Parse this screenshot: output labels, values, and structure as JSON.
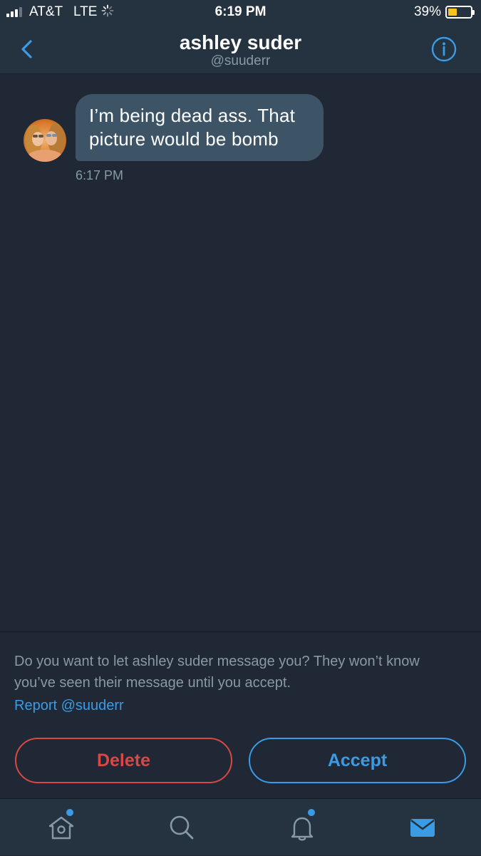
{
  "status_bar": {
    "carrier": "AT&T",
    "network": "LTE",
    "time": "6:19 PM",
    "battery_percent_label": "39%",
    "battery_level": 0.39
  },
  "header": {
    "title": "ashley suder",
    "handle": "@suuderr",
    "back_icon": "chevron-left-icon",
    "info_icon": "info-icon"
  },
  "conversation": {
    "messages": [
      {
        "text": "I’m being dead ass. That picture would be bomb",
        "time": "6:17 PM"
      }
    ]
  },
  "request": {
    "prompt": "Do you want to let ashley suder message you? They won’t know you’ve seen their message until you accept.",
    "report_label": "Report @suuderr",
    "delete_label": "Delete",
    "accept_label": "Accept"
  },
  "tabbar": {
    "items": [
      {
        "icon": "home-icon",
        "has_badge": true
      },
      {
        "icon": "search-icon",
        "has_badge": false
      },
      {
        "icon": "notifications-icon",
        "has_badge": true
      },
      {
        "icon": "messages-icon",
        "active": true
      }
    ]
  },
  "colors": {
    "background": "#1f2834",
    "header": "#253341",
    "bubble": "#3d5466",
    "accent": "#3a9be6",
    "danger": "#d94844",
    "muted_text": "#8899a6",
    "battery": "#f5c518"
  }
}
